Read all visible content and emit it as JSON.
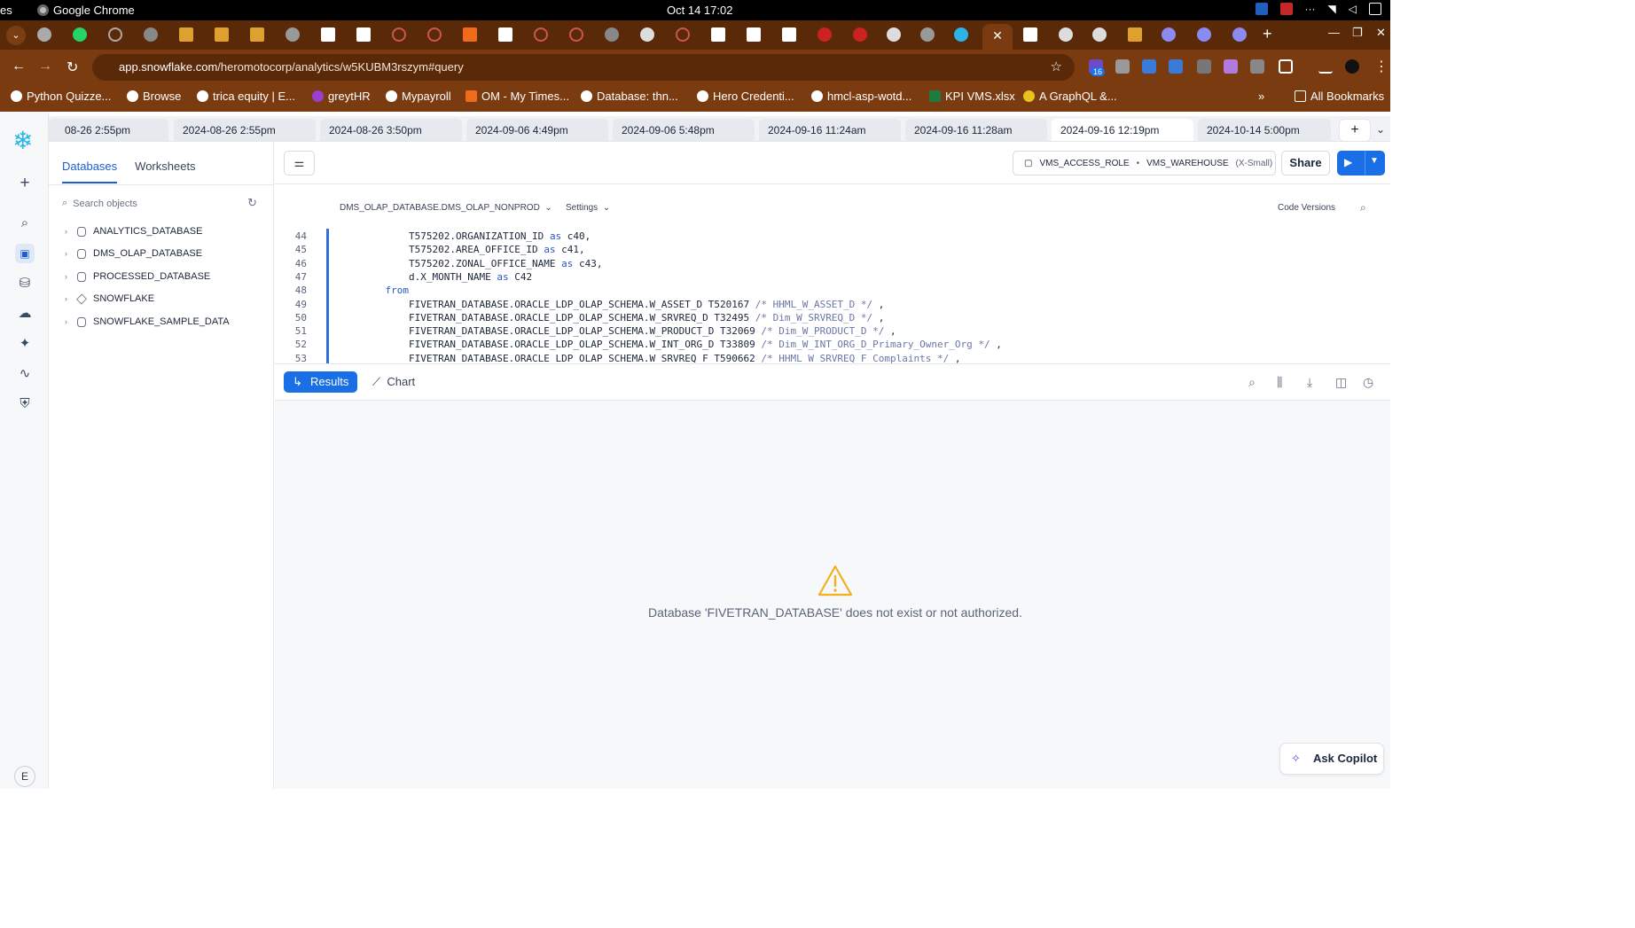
{
  "os": {
    "left_cut": "es",
    "app_name": "Google Chrome",
    "clock": "Oct 14  17:02"
  },
  "browser": {
    "url_host": "app.snowflake.com",
    "url_path": "/heromotocorp/analytics/w5KUBM3rszym#query",
    "extension_badge": "16",
    "bookmarks": [
      "Python Quizze...",
      "Browse",
      "trica equity | E...",
      "greytHR",
      "Mypayroll",
      "OM - My Times...",
      "Database: thn...",
      "Hero Credenti...",
      "hmcl-asp-wotd...",
      "KPI VMS.xlsx",
      "A GraphQL &..."
    ],
    "all_bookmarks": "All Bookmarks",
    "more_bookmarks": "»"
  },
  "worksheet_tabs": [
    "08-26 2:55pm",
    "2024-08-26 2:55pm",
    "2024-08-26 3:50pm",
    "2024-09-06 4:49pm",
    "2024-09-06 5:48pm",
    "2024-09-16 11:24am",
    "2024-09-16 11:28am",
    "2024-09-16 12:19pm",
    "2024-10-14 5:00pm"
  ],
  "object_pane": {
    "tab_databases": "Databases",
    "tab_worksheets": "Worksheets",
    "search_placeholder": "Search objects",
    "databases": [
      "ANALYTICS_DATABASE",
      "DMS_OLAP_DATABASE",
      "PROCESSED_DATABASE",
      "SNOWFLAKE",
      "SNOWFLAKE_SAMPLE_DATA"
    ]
  },
  "toolbar": {
    "role": "VMS_ACCESS_ROLE",
    "warehouse": "VMS_WAREHOUSE",
    "warehouse_size": "(X-Small)",
    "share": "Share"
  },
  "editor_bar": {
    "context": "DMS_OLAP_DATABASE.DMS_OLAP_NONPROD",
    "settings": "Settings",
    "code_versions": "Code Versions"
  },
  "code_lines": [
    {
      "n": "44",
      "indent": "        ",
      "text": "T575202.ORGANIZATION_ID ",
      "kw": "as",
      "tail": " c40,",
      "comment": ""
    },
    {
      "n": "45",
      "indent": "        ",
      "text": "T575202.AREA_OFFICE_ID ",
      "kw": "as",
      "tail": " c41,",
      "comment": ""
    },
    {
      "n": "46",
      "indent": "        ",
      "text": "T575202.ZONAL_OFFICE_NAME ",
      "kw": "as",
      "tail": " c43,",
      "comment": ""
    },
    {
      "n": "47",
      "indent": "        ",
      "text": "d.X_MONTH_NAME ",
      "kw": "as",
      "tail": " C42",
      "comment": ""
    },
    {
      "n": "48",
      "indent": "    ",
      "text": "",
      "kw": "from",
      "tail": "",
      "comment": ""
    },
    {
      "n": "49",
      "indent": "        ",
      "text": "FIVETRAN_DATABASE.ORACLE_LDP_OLAP_SCHEMA.W_ASSET_D T520167 ",
      "kw": "",
      "tail": " ,",
      "comment": "/* HHML_W_ASSET_D */"
    },
    {
      "n": "50",
      "indent": "        ",
      "text": "FIVETRAN_DATABASE.ORACLE_LDP_OLAP_SCHEMA.W_SRVREQ_D T32495 ",
      "kw": "",
      "tail": " ,",
      "comment": "/* Dim_W_SRVREQ_D */"
    },
    {
      "n": "51",
      "indent": "        ",
      "text": "FIVETRAN_DATABASE.ORACLE_LDP_OLAP_SCHEMA.W_PRODUCT_D T32069 ",
      "kw": "",
      "tail": " ,",
      "comment": "/* Dim_W_PRODUCT_D */"
    },
    {
      "n": "52",
      "indent": "        ",
      "text": "FIVETRAN_DATABASE.ORACLE_LDP_OLAP_SCHEMA.W_INT_ORG_D T33809 ",
      "kw": "",
      "tail": " ,",
      "comment": "/* Dim_W_INT_ORG_D_Primary_Owner_Org */"
    },
    {
      "n": "53",
      "indent": "        ",
      "text": "FIVETRAN_DATABASE.ORACLE_LDP_OLAP_SCHEMA.W_SRVREQ_F T590662 ",
      "kw": "",
      "tail": " ,",
      "comment": "/* HHML_W_SRVREQ_F_Complaints */"
    }
  ],
  "results_bar": {
    "results": "Results",
    "chart": "Chart"
  },
  "error": {
    "message": "Database 'FIVETRAN_DATABASE' does not exist or not authorized."
  },
  "copilot": "Ask Copilot",
  "avatar_letter": "E",
  "colors": {
    "accent": "#1a6ee6",
    "chrome_frame": "#7b3b10",
    "snowflake_blue": "#29b5e8",
    "warning": "#f2b01e"
  }
}
